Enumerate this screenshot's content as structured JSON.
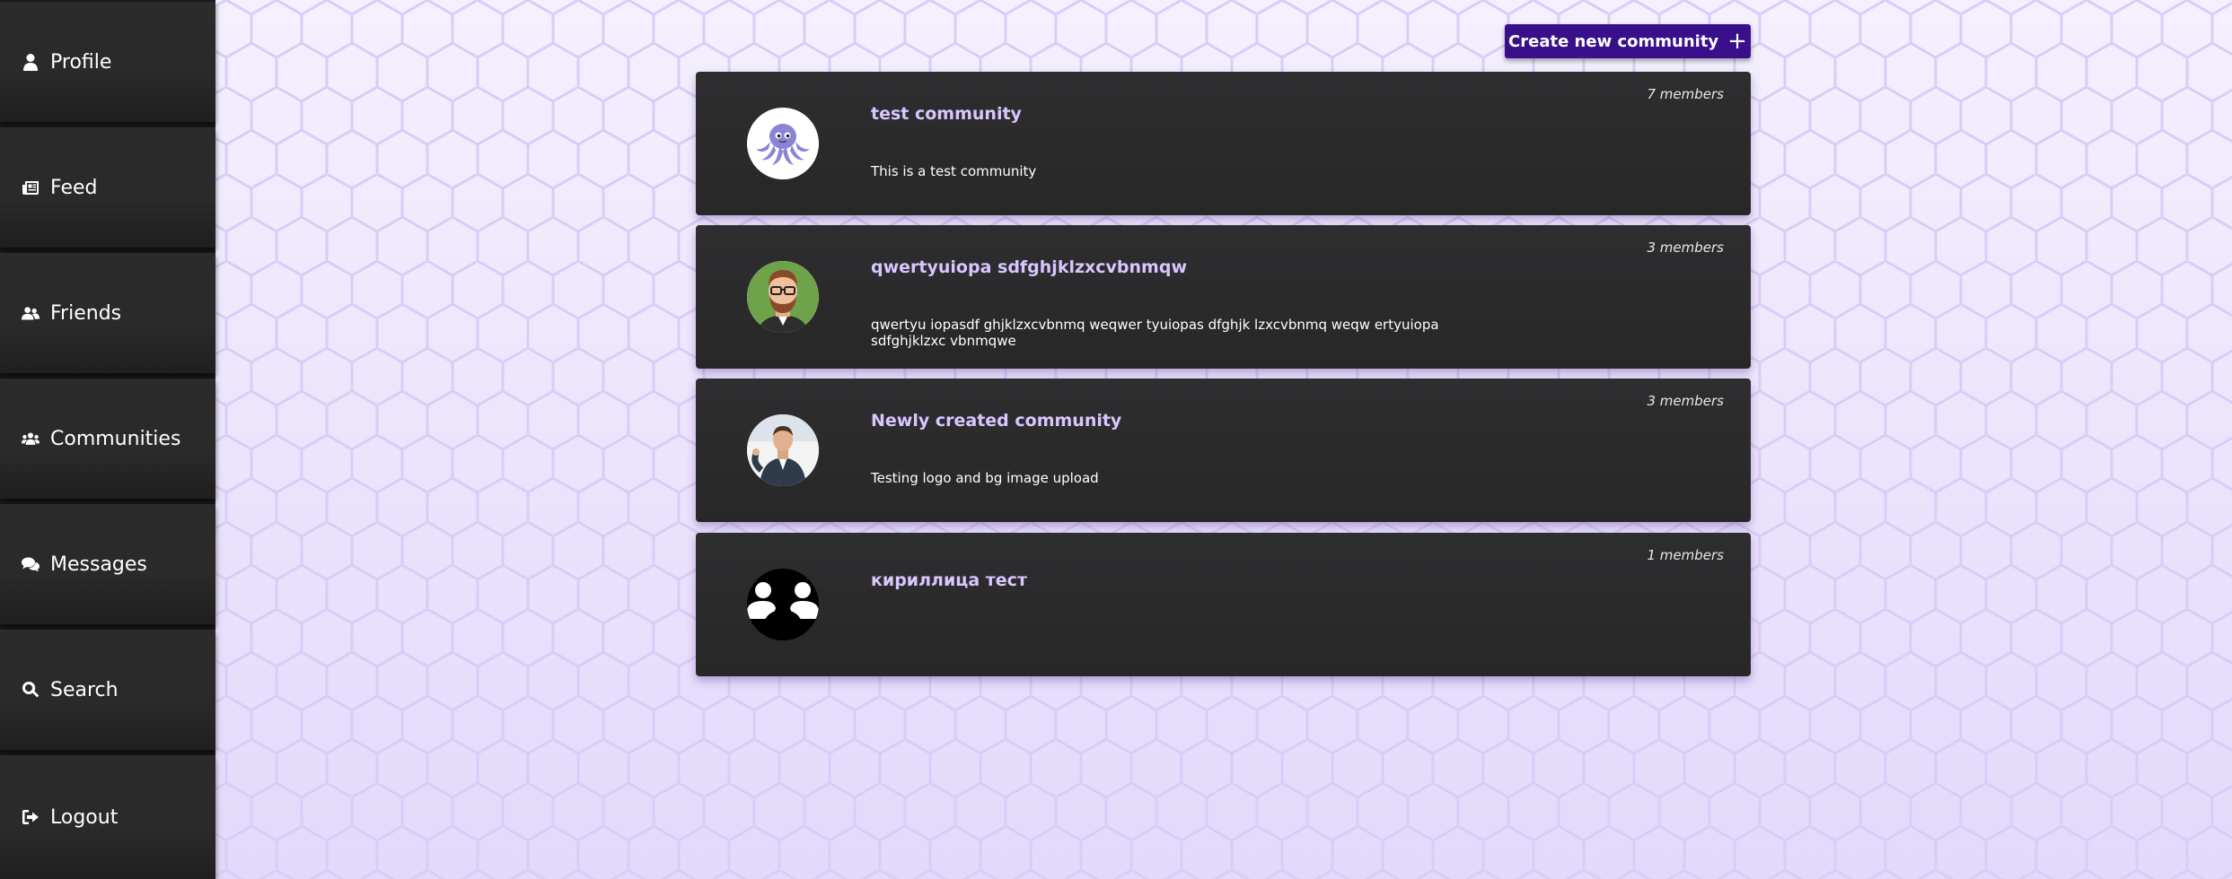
{
  "sidebar": {
    "items": [
      {
        "label": "Profile",
        "icon": "user-icon"
      },
      {
        "label": "Feed",
        "icon": "newspaper-icon"
      },
      {
        "label": "Friends",
        "icon": "user-friends-icon"
      },
      {
        "label": "Communities",
        "icon": "users-icon"
      },
      {
        "label": "Messages",
        "icon": "comments-icon"
      },
      {
        "label": "Search",
        "icon": "search-icon"
      },
      {
        "label": "Logout",
        "icon": "logout-icon"
      }
    ]
  },
  "header": {
    "create_button_label": "Create new community",
    "create_button_icon": "plus-icon"
  },
  "communities": [
    {
      "name": "test community",
      "members": "7 members",
      "description": "This is a test community",
      "avatar": "octopus-avatar"
    },
    {
      "name": "qwertyuiopa sdfghjklzxcvbnmqw",
      "members": "3 members",
      "description": "qwertyu iopasdf ghjklzxcvbnmq weqwer tyuiopas dfghjk lzxcvbnmq weqw ertyuiopa sdfghjklzxc vbnmqwe",
      "avatar": "bearded-man-avatar"
    },
    {
      "name": "Newly created community",
      "members": "3 members",
      "description": "Testing logo and bg image upload",
      "avatar": "businessman-avatar"
    },
    {
      "name": "кириллица тест",
      "members": "1 members",
      "description": "",
      "avatar": "group-silhouette-avatar"
    }
  ],
  "colors": {
    "accent": "#3a0f8c",
    "card_title": "#d9c6ff",
    "sidebar_bg": "#2b2b2b",
    "page_bg": "#ece6fb"
  }
}
